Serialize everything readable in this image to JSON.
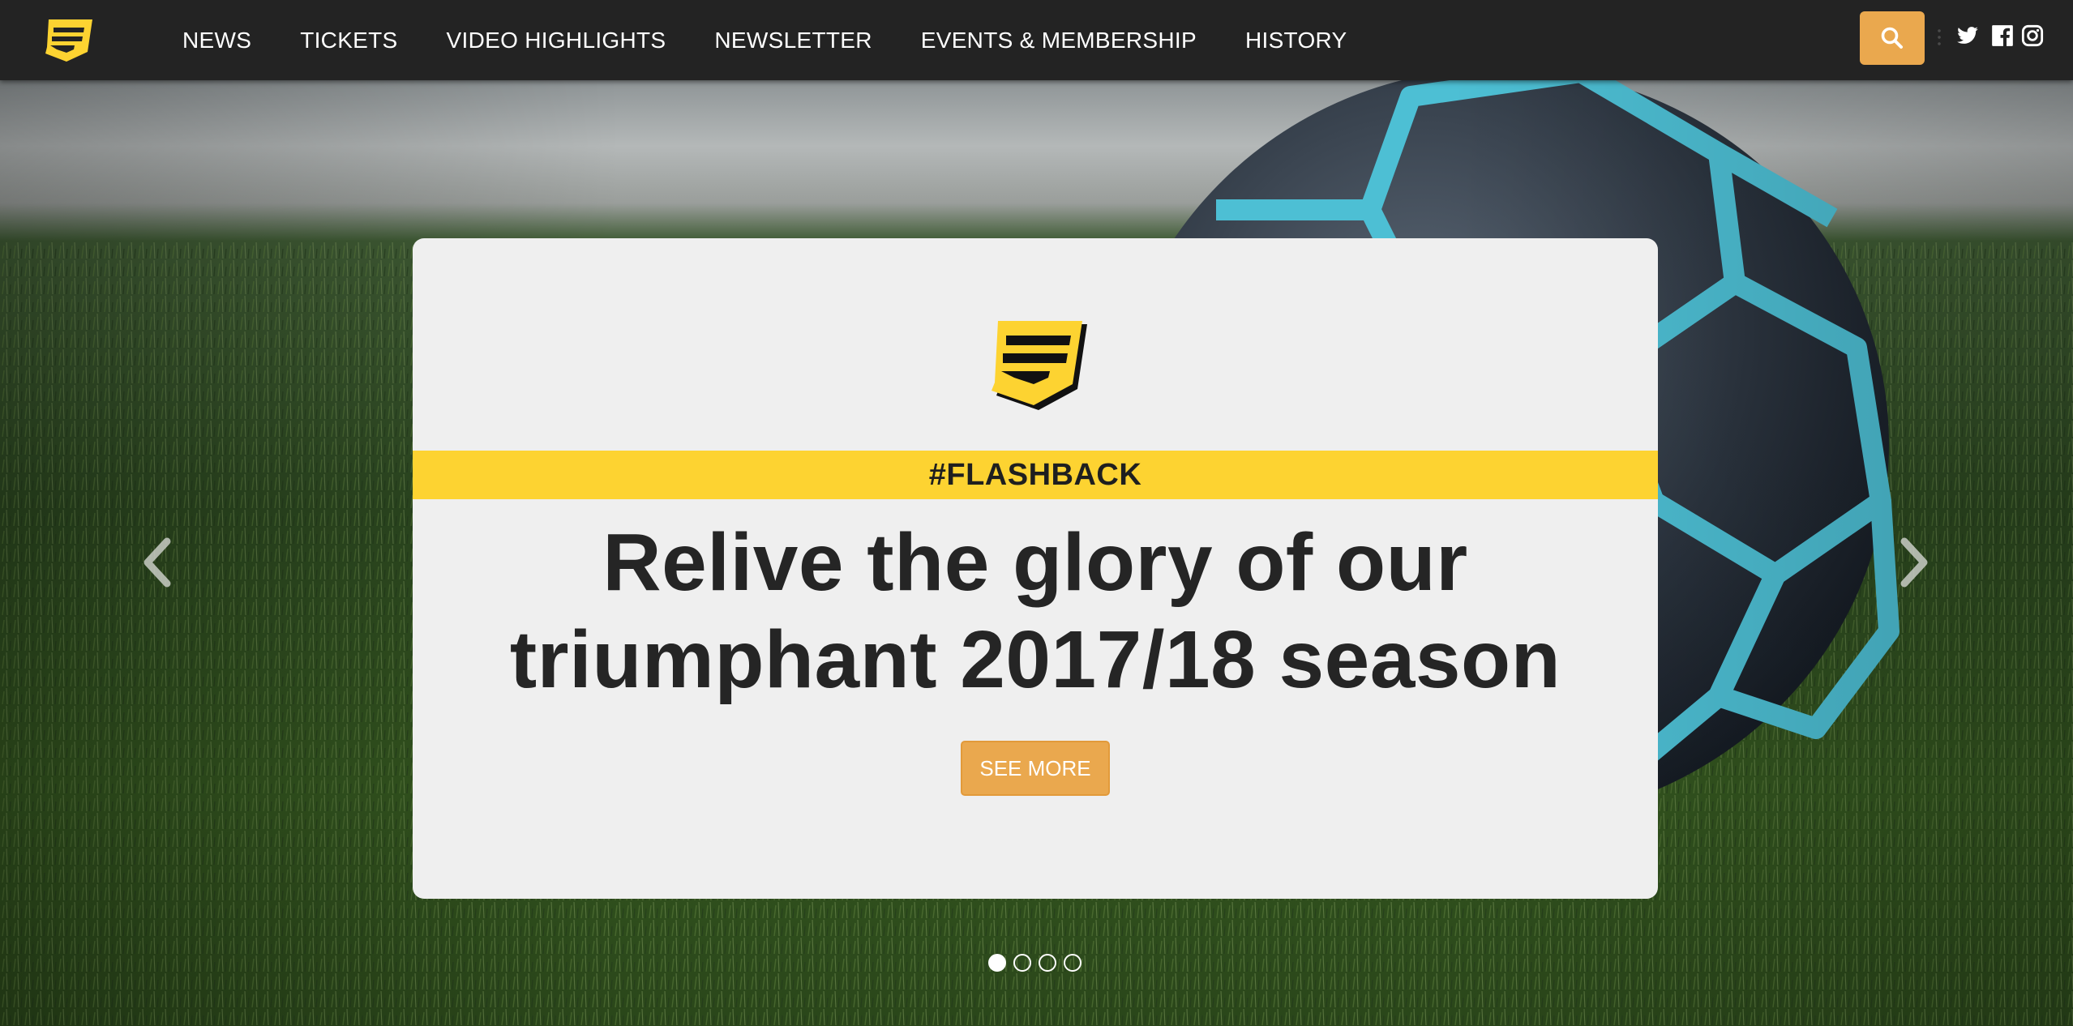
{
  "nav": {
    "logo": "css3-shield-logo",
    "links": [
      {
        "label": "NEWS"
      },
      {
        "label": "TICKETS"
      },
      {
        "label": "VIDEO HIGHLIGHTS"
      },
      {
        "label": "NEWSLETTER"
      },
      {
        "label": "EVENTS & MEMBERSHIP"
      },
      {
        "label": "HISTORY"
      }
    ],
    "search_icon": "search-icon",
    "social": [
      "twitter-icon",
      "facebook-icon",
      "instagram-icon"
    ]
  },
  "hero": {
    "background": "soccer-ball-on-grass-photo",
    "card": {
      "tag": "#FLASHBACK",
      "headline": "Relive the glory of our triumphant 2017/18 season",
      "button_label": "SEE MORE"
    },
    "carousel": {
      "slides": 4,
      "active_index": 0
    }
  },
  "colors": {
    "nav_bg": "#232323",
    "accent_orange": "#eaa84e",
    "accent_yellow": "#fdd331",
    "card_bg": "#efefef",
    "headline_text": "#252525"
  }
}
